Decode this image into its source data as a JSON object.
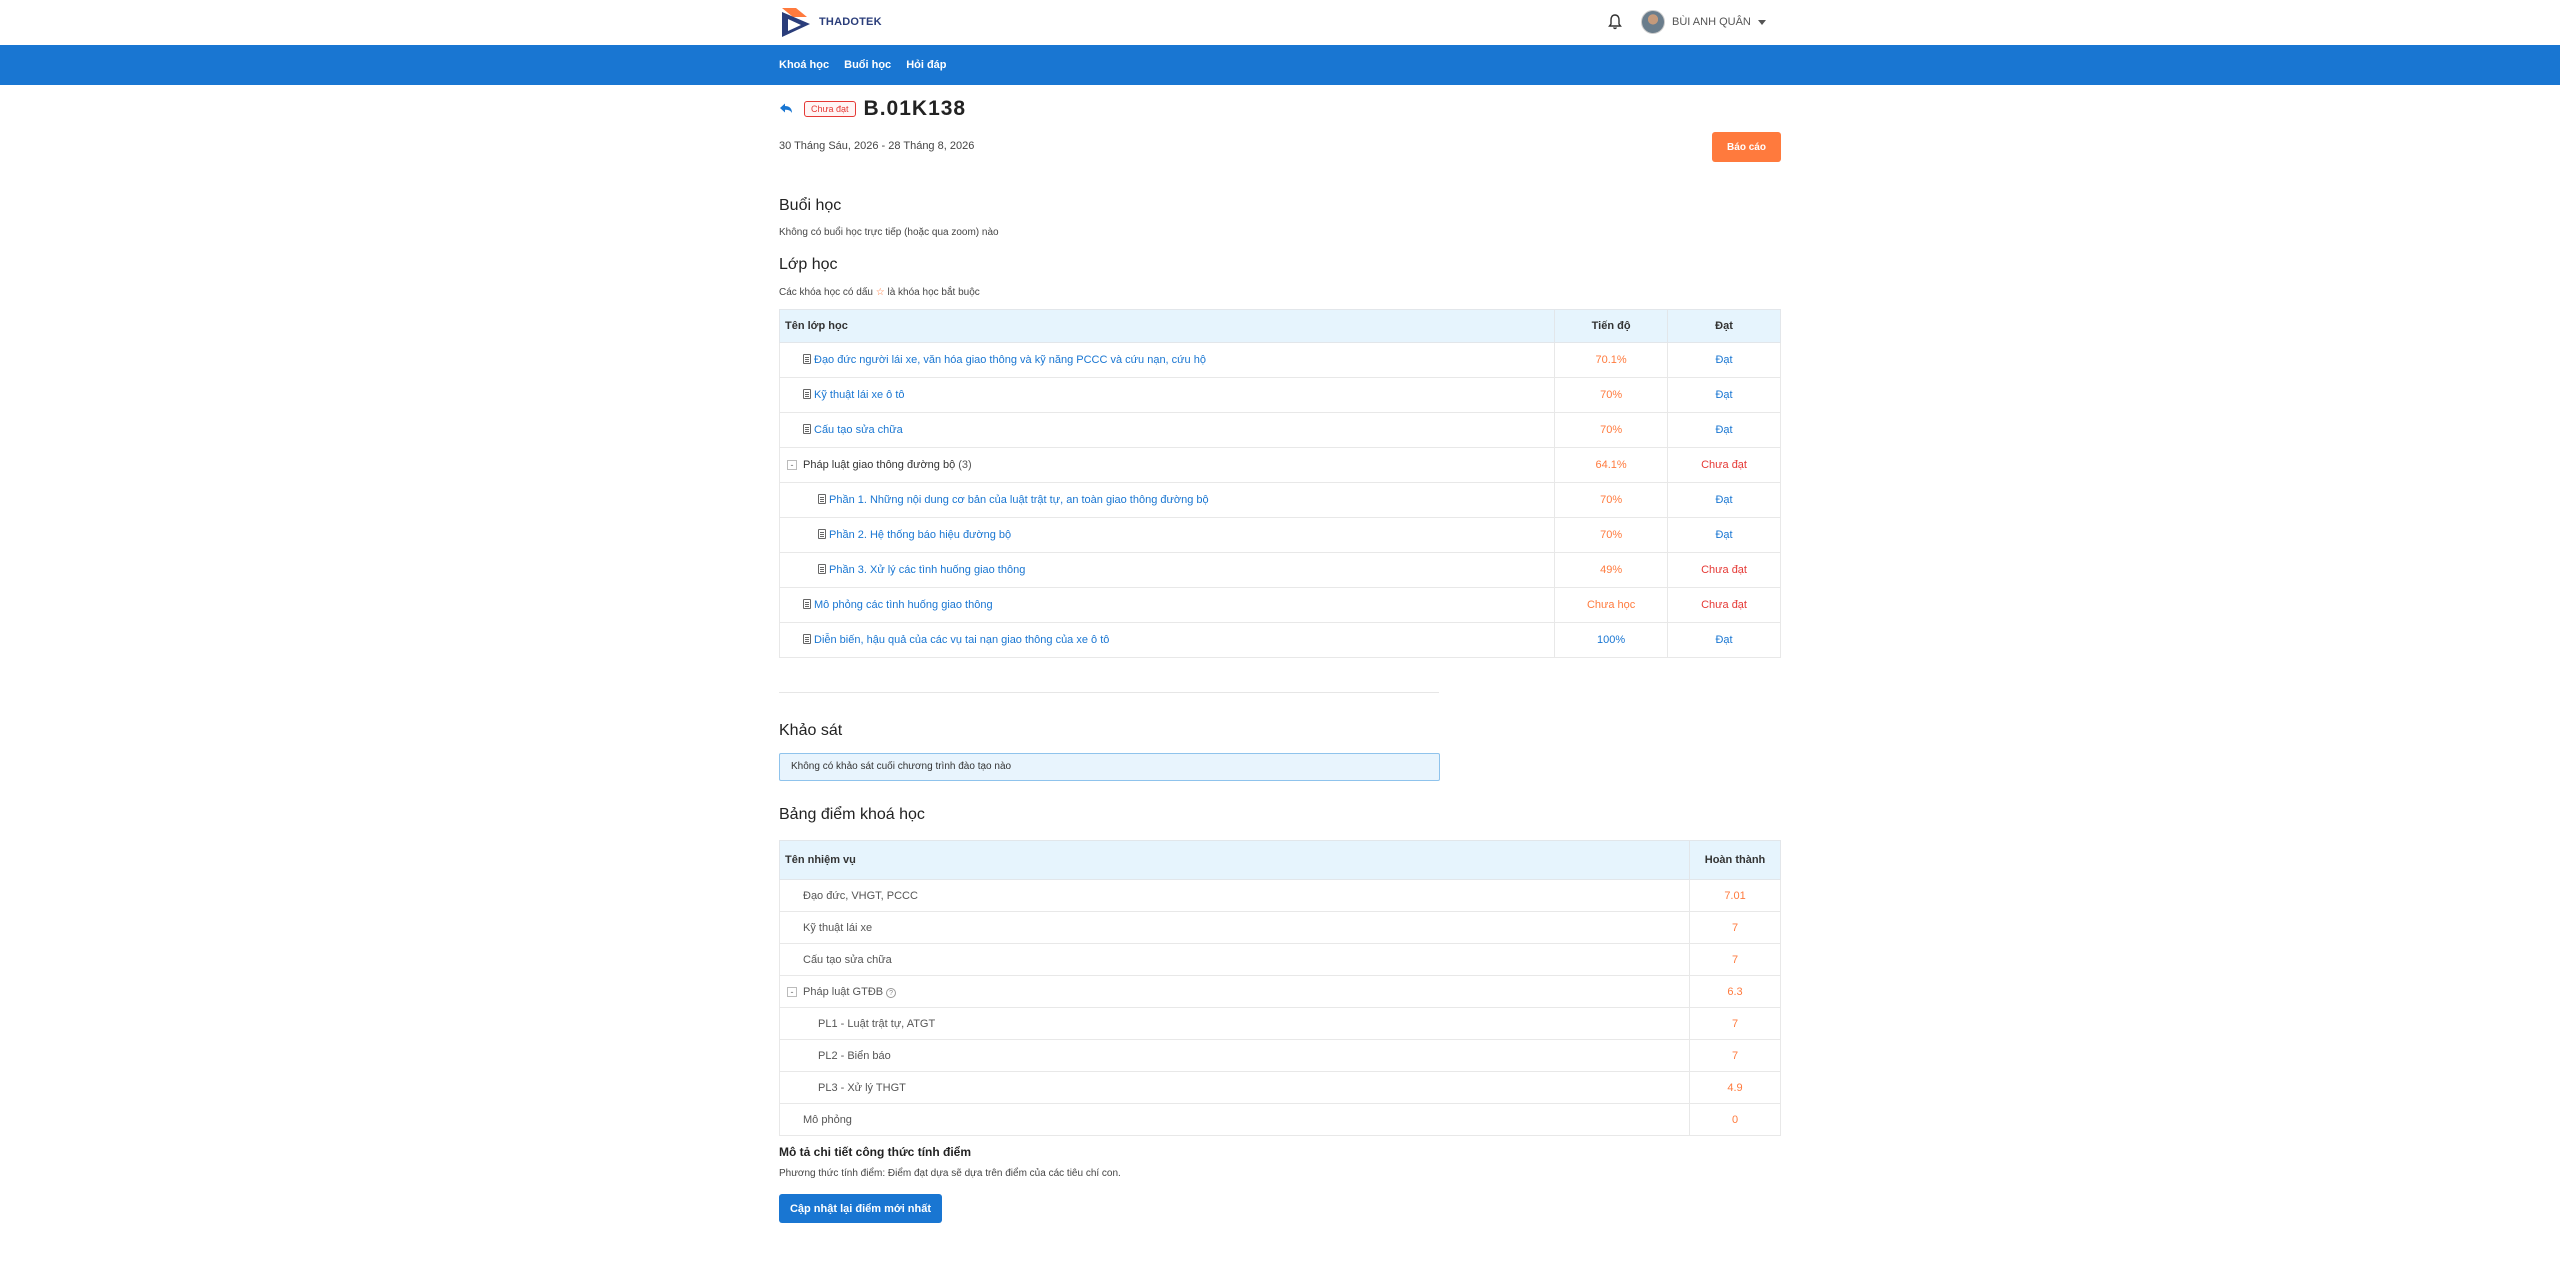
{
  "header": {
    "logo_text": "THADOTEK",
    "user_name": "BÙI ANH QUÂN"
  },
  "nav": {
    "items": [
      "Khoá học",
      "Buổi học",
      "Hỏi đáp"
    ]
  },
  "course": {
    "status_badge": "Chưa đạt",
    "code": "B.01K138",
    "date_range": "30 Tháng Sáu, 2026 - 28 Tháng 8, 2026",
    "report_label": "Báo cáo"
  },
  "sessions": {
    "title": "Buổi học",
    "empty_text": "Không có buổi học trực tiếp (hoặc qua zoom) nào"
  },
  "classes": {
    "title": "Lớp học",
    "note_before": "Các khóa học có dấu",
    "note_star": "☆",
    "note_after": "là khóa học bắt buộc",
    "columns": [
      "Tên lớp học",
      "Tiến độ",
      "Đạt"
    ],
    "rows": [
      {
        "name": "Đạo đức người lái xe, văn hóa giao thông và kỹ năng PCCC và cứu nạn, cứu hộ",
        "progress": "70.1%",
        "status": "Đạt"
      },
      {
        "name": "Kỹ thuật lái xe ô tô",
        "progress": "70%",
        "status": "Đạt"
      },
      {
        "name": "Cấu tạo sửa chữa",
        "progress": "70%",
        "status": "Đạt"
      },
      {
        "name": "Pháp luật giao thông đường bộ",
        "count": "(3)",
        "progress": "64.1%",
        "status": "Chưa đạt",
        "toggle": "-"
      },
      {
        "name": "Phần 1. Những nội dung cơ bản của luật trật tự, an toàn giao thông đường bộ",
        "progress": "70%",
        "status": "Đạt"
      },
      {
        "name": "Phần 2. Hệ thống báo hiệu đường bộ",
        "progress": "70%",
        "status": "Đạt"
      },
      {
        "name": "Phần 3. Xử lý các tình huống giao thông",
        "progress": "49%",
        "status": "Chưa đạt"
      },
      {
        "name": "Mô phỏng các tình huống giao thông",
        "progress": "Chưa học",
        "status": "Chưa đạt"
      },
      {
        "name": "Diễn biến, hậu quả của các vụ tai nạn giao thông của xe ô tô",
        "progress": "100%",
        "status": "Đạt"
      }
    ]
  },
  "survey": {
    "title": "Khảo sát",
    "empty_text": "Không có khảo sát cuối chương trình đào tạo nào"
  },
  "grades": {
    "title": "Bảng điểm khoá học",
    "columns": [
      "Tên nhiệm vụ",
      "Hoàn thành"
    ],
    "rows": [
      {
        "name": "Đạo đức, VHGT, PCCC",
        "score": "7.01"
      },
      {
        "name": "Kỹ thuật lái xe",
        "score": "7"
      },
      {
        "name": "Cấu tạo sửa chữa",
        "score": "7"
      },
      {
        "name": "Pháp luật GTĐB",
        "score": "6.3",
        "toggle": "-"
      },
      {
        "name": "PL1 - Luật trật tự, ATGT",
        "score": "7"
      },
      {
        "name": "PL2 - Biển báo",
        "score": "7"
      },
      {
        "name": "PL3 - Xử lý THGT",
        "score": "4.9"
      },
      {
        "name": "Mô phỏng",
        "score": "0"
      }
    ],
    "formula_title": "Mô tả chi tiết công thức tính điểm",
    "formula_text": "Phương thức tính điểm: Điểm đạt dựa sẽ dựa trên điểm của các tiêu chí con.",
    "update_label": "Cập nhật lại điểm mới nhất"
  },
  "colors": {
    "primary": "#1976d2",
    "accent": "#ff7a3d",
    "fail": "#e53935",
    "table_header": "#e6f4fd"
  }
}
